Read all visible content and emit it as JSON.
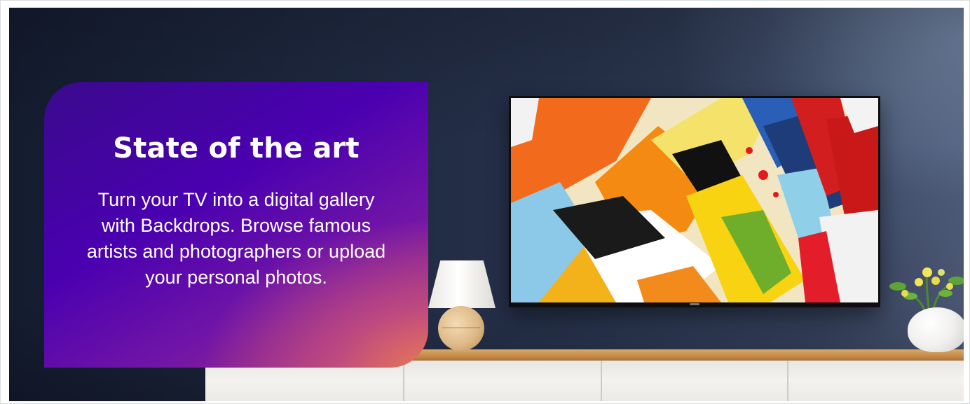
{
  "promo": {
    "title": "State of the art",
    "body": "Turn your TV into a digital gallery with Backdrops. Browse famous artists and photographers or upload your personal photos."
  },
  "colors": {
    "card_gradient_start": "#4a00b0",
    "card_gradient_end": "#f0825a",
    "wall": "#27324b",
    "text": "#ffffff"
  }
}
